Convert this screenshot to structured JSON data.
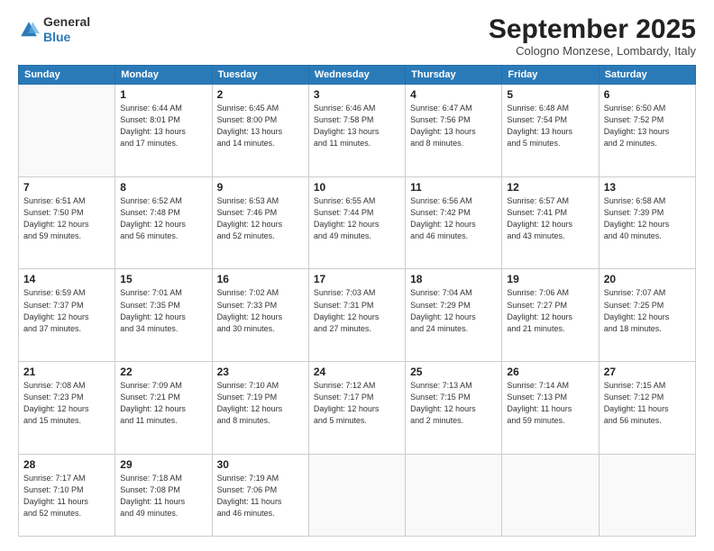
{
  "logo": {
    "general": "General",
    "blue": "Blue"
  },
  "header": {
    "month": "September 2025",
    "location": "Cologno Monzese, Lombardy, Italy"
  },
  "weekdays": [
    "Sunday",
    "Monday",
    "Tuesday",
    "Wednesday",
    "Thursday",
    "Friday",
    "Saturday"
  ],
  "weeks": [
    [
      {
        "day": "",
        "info": ""
      },
      {
        "day": "1",
        "info": "Sunrise: 6:44 AM\nSunset: 8:01 PM\nDaylight: 13 hours\nand 17 minutes."
      },
      {
        "day": "2",
        "info": "Sunrise: 6:45 AM\nSunset: 8:00 PM\nDaylight: 13 hours\nand 14 minutes."
      },
      {
        "day": "3",
        "info": "Sunrise: 6:46 AM\nSunset: 7:58 PM\nDaylight: 13 hours\nand 11 minutes."
      },
      {
        "day": "4",
        "info": "Sunrise: 6:47 AM\nSunset: 7:56 PM\nDaylight: 13 hours\nand 8 minutes."
      },
      {
        "day": "5",
        "info": "Sunrise: 6:48 AM\nSunset: 7:54 PM\nDaylight: 13 hours\nand 5 minutes."
      },
      {
        "day": "6",
        "info": "Sunrise: 6:50 AM\nSunset: 7:52 PM\nDaylight: 13 hours\nand 2 minutes."
      }
    ],
    [
      {
        "day": "7",
        "info": "Sunrise: 6:51 AM\nSunset: 7:50 PM\nDaylight: 12 hours\nand 59 minutes."
      },
      {
        "day": "8",
        "info": "Sunrise: 6:52 AM\nSunset: 7:48 PM\nDaylight: 12 hours\nand 56 minutes."
      },
      {
        "day": "9",
        "info": "Sunrise: 6:53 AM\nSunset: 7:46 PM\nDaylight: 12 hours\nand 52 minutes."
      },
      {
        "day": "10",
        "info": "Sunrise: 6:55 AM\nSunset: 7:44 PM\nDaylight: 12 hours\nand 49 minutes."
      },
      {
        "day": "11",
        "info": "Sunrise: 6:56 AM\nSunset: 7:42 PM\nDaylight: 12 hours\nand 46 minutes."
      },
      {
        "day": "12",
        "info": "Sunrise: 6:57 AM\nSunset: 7:41 PM\nDaylight: 12 hours\nand 43 minutes."
      },
      {
        "day": "13",
        "info": "Sunrise: 6:58 AM\nSunset: 7:39 PM\nDaylight: 12 hours\nand 40 minutes."
      }
    ],
    [
      {
        "day": "14",
        "info": "Sunrise: 6:59 AM\nSunset: 7:37 PM\nDaylight: 12 hours\nand 37 minutes."
      },
      {
        "day": "15",
        "info": "Sunrise: 7:01 AM\nSunset: 7:35 PM\nDaylight: 12 hours\nand 34 minutes."
      },
      {
        "day": "16",
        "info": "Sunrise: 7:02 AM\nSunset: 7:33 PM\nDaylight: 12 hours\nand 30 minutes."
      },
      {
        "day": "17",
        "info": "Sunrise: 7:03 AM\nSunset: 7:31 PM\nDaylight: 12 hours\nand 27 minutes."
      },
      {
        "day": "18",
        "info": "Sunrise: 7:04 AM\nSunset: 7:29 PM\nDaylight: 12 hours\nand 24 minutes."
      },
      {
        "day": "19",
        "info": "Sunrise: 7:06 AM\nSunset: 7:27 PM\nDaylight: 12 hours\nand 21 minutes."
      },
      {
        "day": "20",
        "info": "Sunrise: 7:07 AM\nSunset: 7:25 PM\nDaylight: 12 hours\nand 18 minutes."
      }
    ],
    [
      {
        "day": "21",
        "info": "Sunrise: 7:08 AM\nSunset: 7:23 PM\nDaylight: 12 hours\nand 15 minutes."
      },
      {
        "day": "22",
        "info": "Sunrise: 7:09 AM\nSunset: 7:21 PM\nDaylight: 12 hours\nand 11 minutes."
      },
      {
        "day": "23",
        "info": "Sunrise: 7:10 AM\nSunset: 7:19 PM\nDaylight: 12 hours\nand 8 minutes."
      },
      {
        "day": "24",
        "info": "Sunrise: 7:12 AM\nSunset: 7:17 PM\nDaylight: 12 hours\nand 5 minutes."
      },
      {
        "day": "25",
        "info": "Sunrise: 7:13 AM\nSunset: 7:15 PM\nDaylight: 12 hours\nand 2 minutes."
      },
      {
        "day": "26",
        "info": "Sunrise: 7:14 AM\nSunset: 7:13 PM\nDaylight: 11 hours\nand 59 minutes."
      },
      {
        "day": "27",
        "info": "Sunrise: 7:15 AM\nSunset: 7:12 PM\nDaylight: 11 hours\nand 56 minutes."
      }
    ],
    [
      {
        "day": "28",
        "info": "Sunrise: 7:17 AM\nSunset: 7:10 PM\nDaylight: 11 hours\nand 52 minutes."
      },
      {
        "day": "29",
        "info": "Sunrise: 7:18 AM\nSunset: 7:08 PM\nDaylight: 11 hours\nand 49 minutes."
      },
      {
        "day": "30",
        "info": "Sunrise: 7:19 AM\nSunset: 7:06 PM\nDaylight: 11 hours\nand 46 minutes."
      },
      {
        "day": "",
        "info": ""
      },
      {
        "day": "",
        "info": ""
      },
      {
        "day": "",
        "info": ""
      },
      {
        "day": "",
        "info": ""
      }
    ]
  ]
}
